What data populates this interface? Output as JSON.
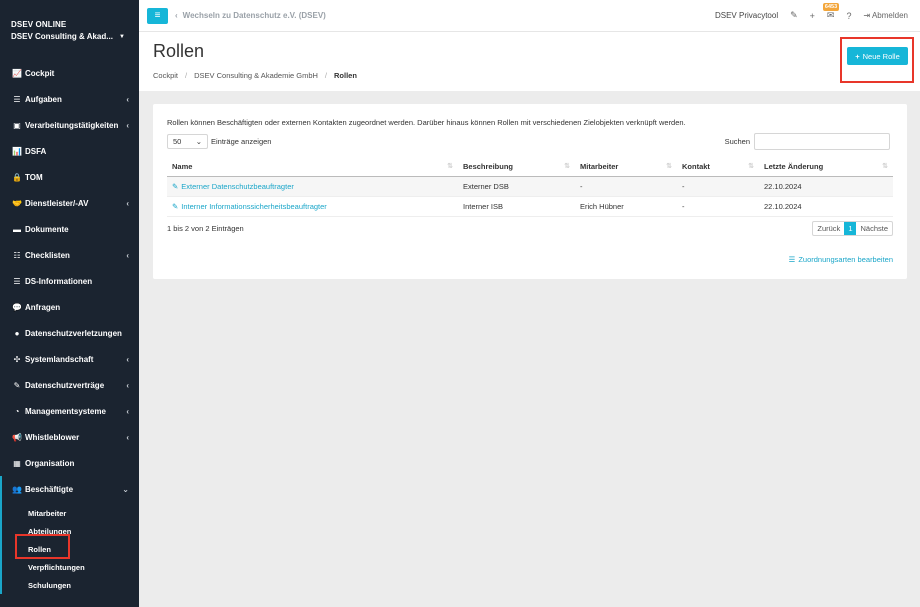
{
  "sidebar": {
    "brand_title": "DSEV ONLINE",
    "brand_org": "DSEV Consulting & Akad...",
    "items": [
      {
        "label": "Cockpit",
        "icon": "chart-icon",
        "glyph": "📈",
        "chevron": false
      },
      {
        "label": "Aufgaben",
        "icon": "list-icon",
        "glyph": "☰",
        "chevron": true
      },
      {
        "label": "Verarbeitungstätigkeiten",
        "icon": "briefcase-icon",
        "glyph": "▣",
        "chevron": true
      },
      {
        "label": "DSFA",
        "icon": "chart-icon",
        "glyph": "📊",
        "chevron": false
      },
      {
        "label": "TOM",
        "icon": "lock-icon",
        "glyph": "🔒",
        "chevron": false
      },
      {
        "label": "Dienstleister/-AV",
        "icon": "handshake-icon",
        "glyph": "🤝",
        "chevron": true
      },
      {
        "label": "Dokumente",
        "icon": "folder-icon",
        "glyph": "▬",
        "chevron": false
      },
      {
        "label": "Checklisten",
        "icon": "checklist-icon",
        "glyph": "☷",
        "chevron": true
      },
      {
        "label": "DS-Informationen",
        "icon": "info-list-icon",
        "glyph": "☰",
        "chevron": false
      },
      {
        "label": "Anfragen",
        "icon": "comments-icon",
        "glyph": "💬",
        "chevron": false
      },
      {
        "label": "Datenschutzverletzungen",
        "icon": "exclamation-icon",
        "glyph": "●",
        "chevron": false
      },
      {
        "label": "Systemlandschaft",
        "icon": "network-icon",
        "glyph": "✣",
        "chevron": true
      },
      {
        "label": "Datenschutzverträge",
        "icon": "contract-icon",
        "glyph": "✎",
        "chevron": true
      },
      {
        "label": "Managementsysteme",
        "icon": "gauge-icon",
        "glyph": "◔",
        "chevron": true
      },
      {
        "label": "Whistleblower",
        "icon": "megaphone-icon",
        "glyph": "📢",
        "chevron": true
      },
      {
        "label": "Organisation",
        "icon": "building-icon",
        "glyph": "▦",
        "chevron": false
      },
      {
        "label": "Beschäftigte",
        "icon": "users-icon",
        "glyph": "👥",
        "chevron": "open"
      }
    ],
    "subitems": [
      "Mitarbeiter",
      "Abteilungen",
      "Rollen",
      "Verpflichtungen",
      "Schulungen"
    ]
  },
  "topbar": {
    "back_label": "Wechseln zu Datenschutz e.V. (DSEV)",
    "tool_label": "DSEV Privacytool",
    "badge_count": "6453",
    "logout_label": "Abmelden"
  },
  "header": {
    "title": "Rollen",
    "breadcrumb": [
      "Cockpit",
      "DSEV Consulting & Akademie GmbH",
      "Rollen"
    ],
    "new_button_label": "Neue Rolle"
  },
  "card": {
    "intro": "Rollen können Beschäftigten oder externen Kontakten zugeordnet werden. Darüber hinaus können Rollen mit verschiedenen Zielobjekten verknüpft werden.",
    "page_length": "50",
    "page_length_suffix": "Einträge anzeigen",
    "search_label": "Suchen",
    "columns": [
      "Name",
      "Beschreibung",
      "Mitarbeiter",
      "Kontakt",
      "Letzte Änderung"
    ],
    "rows": [
      [
        "Externer Datenschutzbeauftragter",
        "Externer DSB",
        "-",
        "-",
        "22.10.2024"
      ],
      [
        "Interner Informationssicherheitsbeauftragter",
        "Interner ISB",
        "Erich Hübner",
        "-",
        "22.10.2024"
      ]
    ],
    "info": "1 bis 2 von 2 Einträgen",
    "pager": {
      "prev": "Zurück",
      "current": "1",
      "next": "Nächste"
    },
    "zuordnung_link": "Zuordnungsarten bearbeiten"
  },
  "colors": {
    "accent": "#16b6d8",
    "sidebar_bg": "#1b2430",
    "highlight": "#e8362a"
  }
}
